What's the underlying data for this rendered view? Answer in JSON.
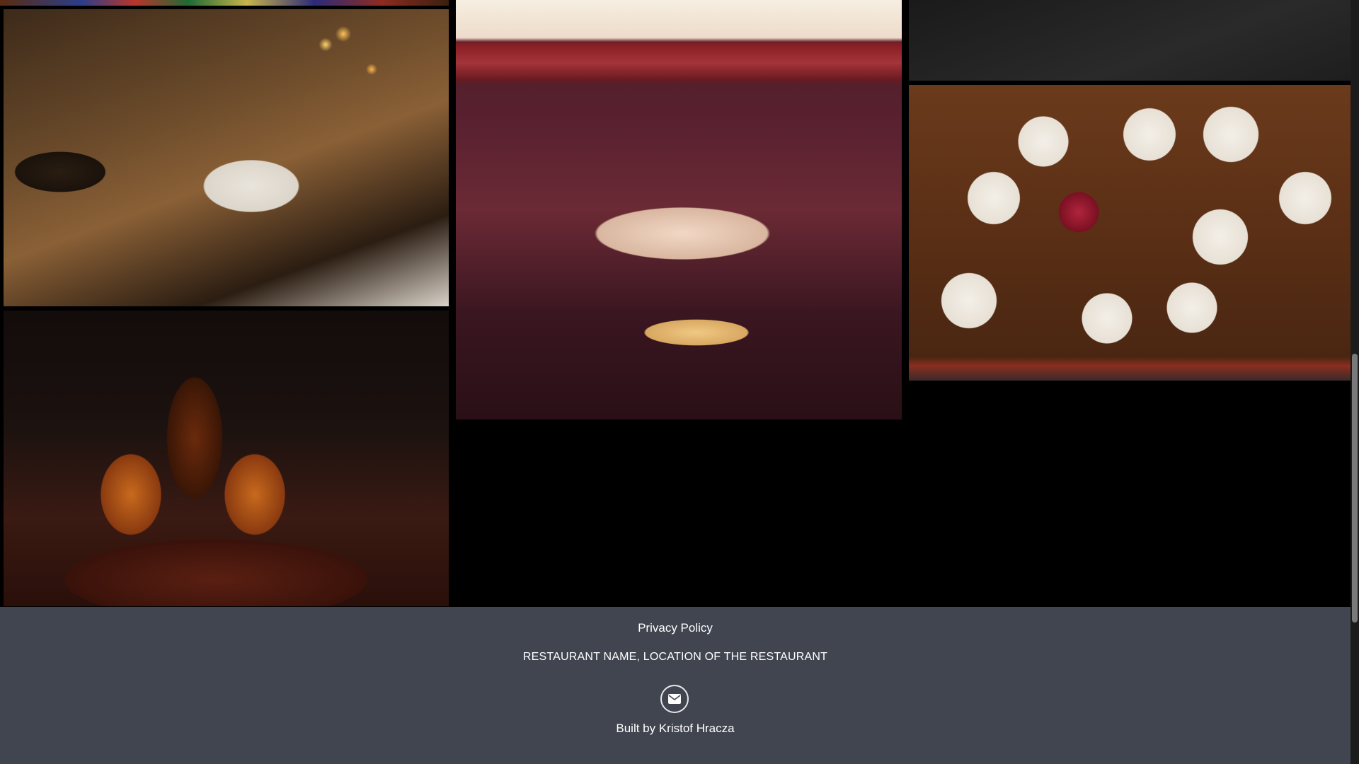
{
  "footer": {
    "privacy_label": "Privacy Policy",
    "address": "RESTAURANT NAME, LOCATION OF THE RESTAURANT",
    "contact_icon": "envelope-icon",
    "credit": "Built by Kristof Hracza"
  },
  "colors": {
    "footer_background": "#40454f",
    "page_background": "#000000",
    "text": "#ffffff"
  }
}
